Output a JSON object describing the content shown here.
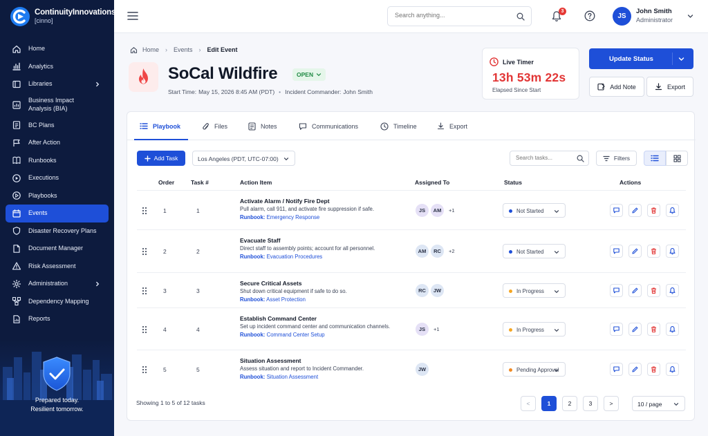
{
  "brand": {
    "name": "ContinuityInnovations",
    "sub": "[cinno]"
  },
  "sidebar": {
    "items": [
      {
        "label": "Home",
        "icon": "home-icon"
      },
      {
        "label": "Analytics",
        "icon": "analytics-icon"
      },
      {
        "label": "Libraries",
        "icon": "library-icon",
        "chevron": true
      },
      {
        "label": "Business Impact Analysis (BIA)",
        "icon": "bia-icon"
      },
      {
        "label": "BC Plans",
        "icon": "bc-plans-icon"
      },
      {
        "label": "After Action",
        "icon": "after-action-icon"
      },
      {
        "label": "Runbooks",
        "icon": "runbook-icon"
      },
      {
        "label": "Executions",
        "icon": "execution-icon"
      },
      {
        "label": "Playbooks",
        "icon": "playbook-icon"
      },
      {
        "label": "Events",
        "icon": "events-icon",
        "active": true
      },
      {
        "label": "Disaster Recovery Plans",
        "icon": "shield-icon"
      },
      {
        "label": "Document Manager",
        "icon": "document-icon"
      },
      {
        "label": "Risk Assessment",
        "icon": "warning-icon"
      },
      {
        "label": "Administration",
        "icon": "gear-icon",
        "chevron": true
      },
      {
        "label": "Dependency Mapping",
        "icon": "network-icon"
      },
      {
        "label": "Reports",
        "icon": "report-icon"
      }
    ],
    "tagline1": "Prepared today.",
    "tagline2": "Resilient tomorrow."
  },
  "header": {
    "search_placeholder": "Search anything...",
    "notif_count": "3",
    "user_initials": "JS",
    "user_name": "John Smith",
    "user_role": "Administrator"
  },
  "breadcrumb": {
    "home": "Home",
    "events": "Events",
    "current": "Edit Event"
  },
  "event": {
    "title": "SoCal Wildfire",
    "status": "OPEN",
    "start_label": "Start Time:",
    "start": "May 15, 2026 8:45 AM (PDT)",
    "ic_label": "Incident Commander:",
    "ic": "John Smith"
  },
  "timer": {
    "label": "Live Timer",
    "value": "13h 53m 22s",
    "sub": "Elapsed Since Start"
  },
  "actions": {
    "update": "Update Status",
    "add_note": "Add Note",
    "export": "Export"
  },
  "tabs": [
    "Playbook",
    "Files",
    "Notes",
    "Communications",
    "Timeline",
    "Export"
  ],
  "toolbar": {
    "add_task": "Add Task",
    "timezone": "Los Angeles (PDT, UTC-07:00)",
    "search_placeholder": "Search tasks...",
    "filters": "Filters"
  },
  "table": {
    "headers": {
      "order": "Order",
      "task": "Task #",
      "action": "Action Item",
      "assigned": "Assigned To",
      "status": "Status",
      "actions": "Actions"
    },
    "runbook_label": "Runbook:",
    "rows": [
      {
        "order": "1",
        "task": "1",
        "title": "Activate Alarm / Notify Fire Dept",
        "desc": "Pull alarm, call 911, and activate fire suppression if safe.",
        "runbook": "Emergency Response",
        "avatars": [
          "JS",
          "AM"
        ],
        "more": "+1",
        "status": "Not Started",
        "status_color": "#1e4fd8"
      },
      {
        "order": "2",
        "task": "2",
        "title": "Evacuate Staff",
        "desc": "Direct staff to assembly points; account for all personnel.",
        "runbook": "Evacuation Procedures",
        "avatars": [
          "AM",
          "RC"
        ],
        "more": "+2",
        "status": "Not Started",
        "status_color": "#1e4fd8"
      },
      {
        "order": "3",
        "task": "3",
        "title": "Secure Critical Assets",
        "desc": "Shut down critical equipment if safe to do so.",
        "runbook": "Asset Protection",
        "avatars": [
          "RC",
          "JW"
        ],
        "more": "",
        "status": "In Progress",
        "status_color": "#f5a623"
      },
      {
        "order": "4",
        "task": "4",
        "title": "Establish Command Center",
        "desc": "Set up incident command center and communication channels.",
        "runbook": "Command Center Setup",
        "avatars": [
          "JS"
        ],
        "more": "+1",
        "status": "In Progress",
        "status_color": "#f5a623"
      },
      {
        "order": "5",
        "task": "5",
        "title": "Situation Assessment",
        "desc": "Assess situation and report to Incident Commander.",
        "runbook": "Situation Assessment",
        "avatars": [
          "JW"
        ],
        "more": "",
        "status": "Pending Approval",
        "status_color": "#f08a24"
      }
    ]
  },
  "footer": {
    "showing": "Showing 1 to 5 of 12 tasks",
    "prev": "<",
    "pages": [
      "1",
      "2",
      "3"
    ],
    "next": ">",
    "per_page": "10 / page"
  },
  "colors": {
    "primary": "#1e4fd8",
    "sidebar": "#0d1b3e",
    "danger": "#e23636",
    "success": "#1f8a44"
  }
}
